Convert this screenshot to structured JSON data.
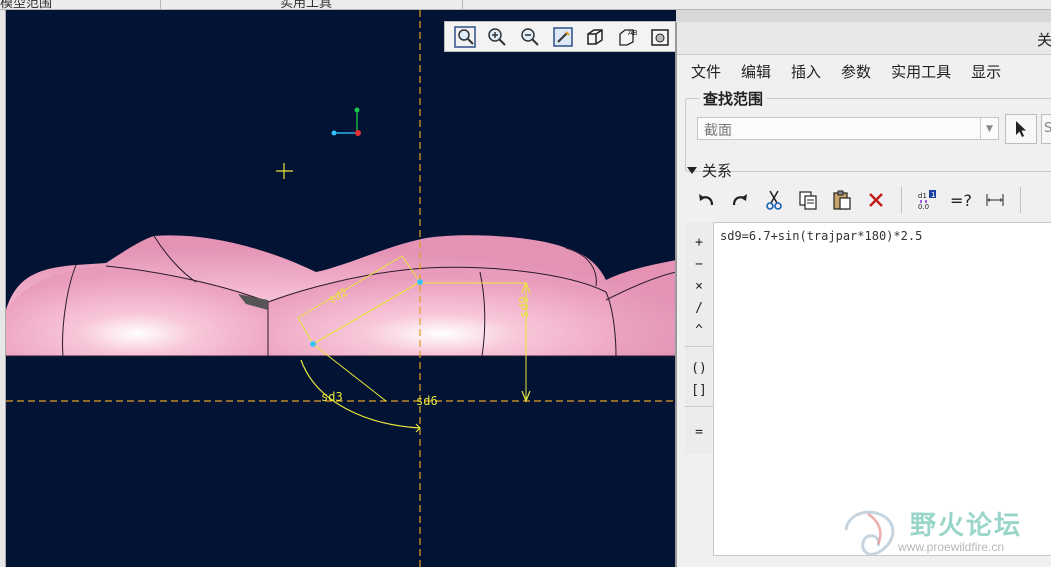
{
  "top_strip": {
    "left_label": "模型范围",
    "center_label": "实用工具"
  },
  "view_toolbar": {
    "buttons": [
      "zoom-refit-icon",
      "zoom-in-icon",
      "zoom-out-icon",
      "repaint-icon",
      "display-style-icon",
      "annotation-display-icon",
      "saved-views-icon"
    ]
  },
  "viewport": {
    "dimension_labels": {
      "sd3": "sd3",
      "sd6": "sd6",
      "sd9": "sd9",
      "sd2": "sd2"
    },
    "colors": {
      "background": "#031334",
      "surface": "#f0a8c4",
      "dimension": "#e8e53a",
      "centerline": "#e0a020"
    }
  },
  "dialog": {
    "title": "关",
    "menu": [
      "文件",
      "编辑",
      "插入",
      "参数",
      "实用工具",
      "显示"
    ],
    "lookup": {
      "legend": "查找范围",
      "combo_value": "截面",
      "side_btn": "S"
    },
    "relations": {
      "header": "关系",
      "operators": [
        "+",
        "−",
        "×",
        "/",
        "^",
        "()",
        "[]",
        "="
      ],
      "content": "sd9=6.7+sin(trajpar*180)*2.5",
      "equal_query": "=?"
    }
  },
  "watermark": {
    "text": "野火论坛",
    "url": "www.proewildfire.cn"
  }
}
